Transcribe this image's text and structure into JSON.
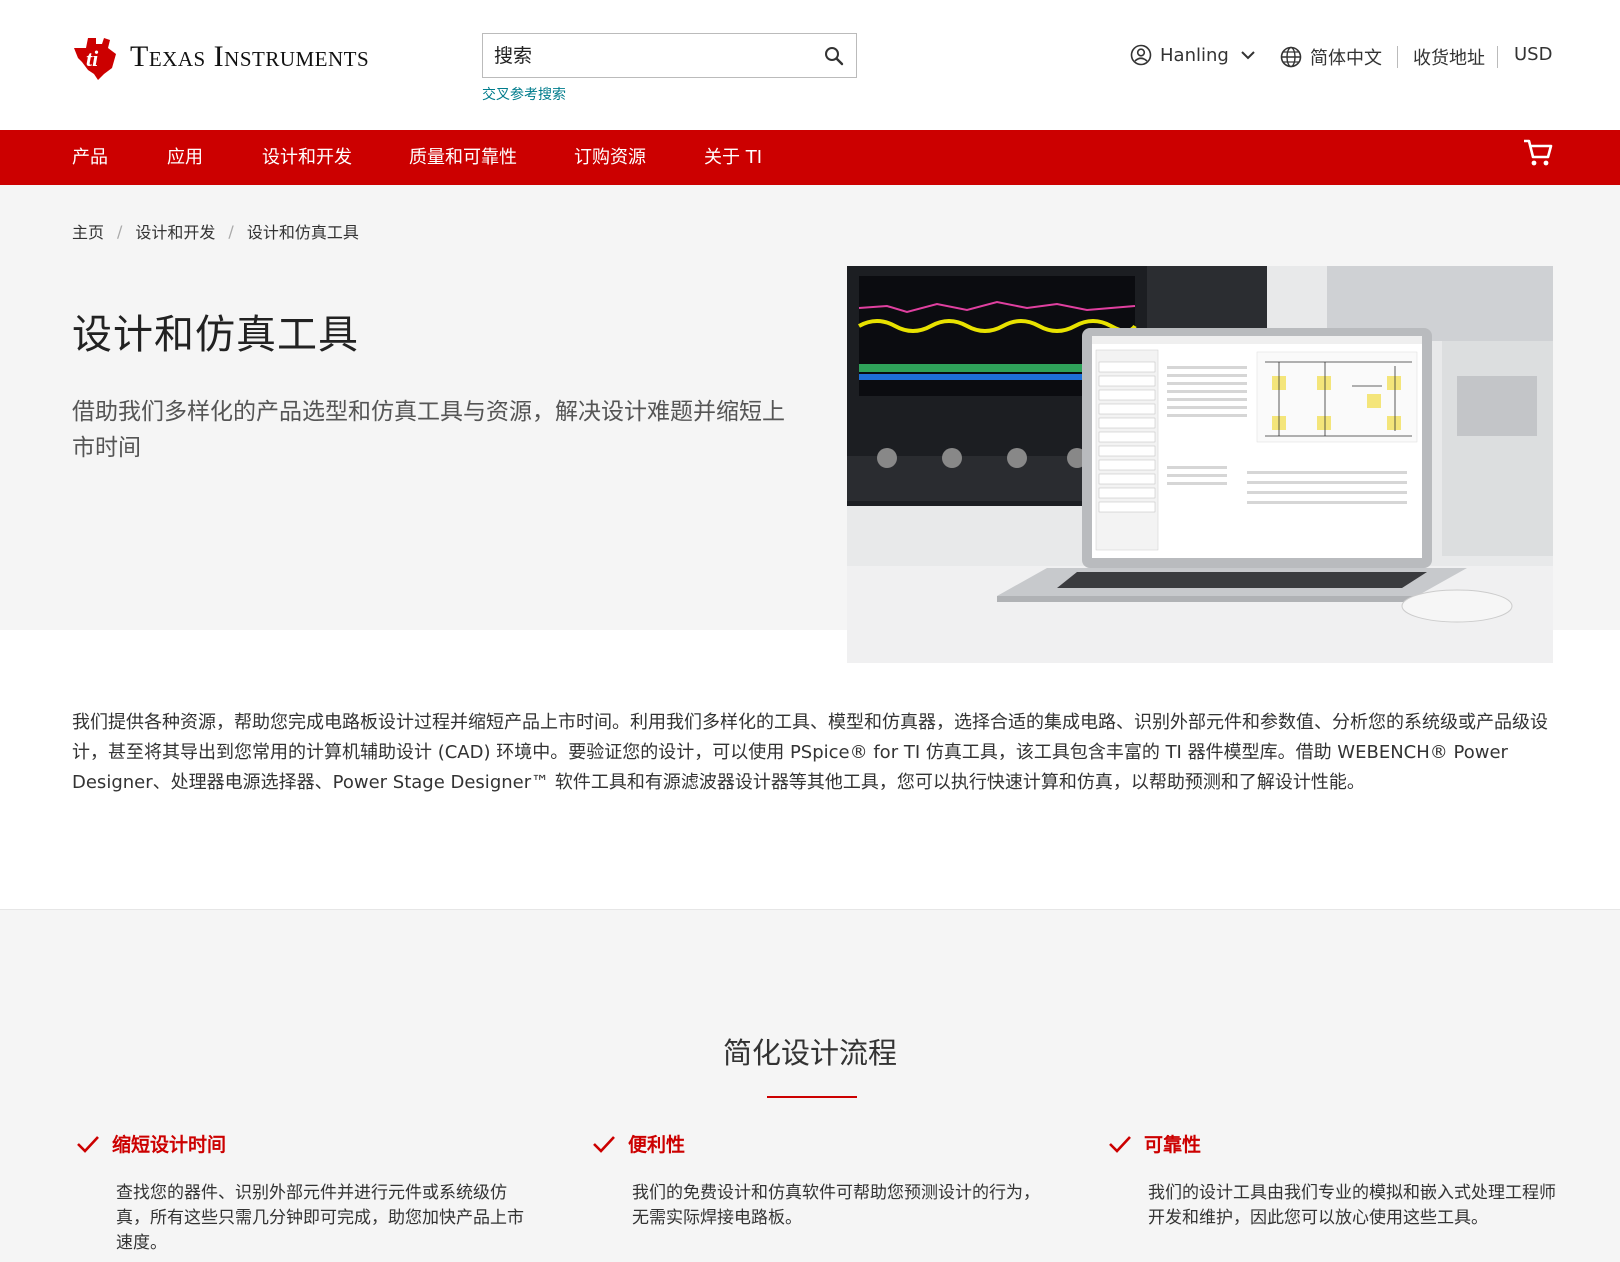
{
  "header": {
    "brand": "Texas Instruments",
    "search_placeholder": "搜索",
    "cross_ref_link": "交叉参考搜索",
    "user_name": "Hanling",
    "language": "简体中文",
    "shipping": "收货地址",
    "currency": "USD"
  },
  "nav": {
    "items": [
      {
        "label": "产品"
      },
      {
        "label": "应用"
      },
      {
        "label": "设计和开发"
      },
      {
        "label": "质量和可靠性"
      },
      {
        "label": "订购资源"
      },
      {
        "label": "关于 TI"
      }
    ]
  },
  "breadcrumb": [
    {
      "label": "主页"
    },
    {
      "label": "设计和开发"
    },
    {
      "label": "设计和仿真工具"
    }
  ],
  "hero": {
    "title": "设计和仿真工具",
    "subtitle": "借助我们多样化的产品选型和仿真工具与资源，解决设计难题并缩短上市时间"
  },
  "intro": "我们提供各种资源，帮助您完成电路板设计过程并缩短产品上市时间。利用我们多样化的工具、模型和仿真器，选择合适的集成电路、识别外部元件和参数值、分析您的系统级或产品级设计，甚至将其导出到您常用的计算机辅助设计 (CAD) 环境中。要验证您的设计，可以使用 PSpice® for TI 仿真工具，该工具包含丰富的 TI 器件模型库。借助 WEBENCH® Power Designer、处理器电源选择器、Power Stage Designer™ 软件工具和有源滤波器设计器等其他工具，您可以执行快速计算和仿真，以帮助预测和了解设计性能。",
  "section": {
    "title": "简化设计流程",
    "features": [
      {
        "title": "缩短设计时间",
        "desc": "查找您的器件、识别外部元件并进行元件或系统级仿真，所有这些只需几分钟即可完成，助您加快产品上市速度。"
      },
      {
        "title": "便利性",
        "desc": "我们的免费设计和仿真软件可帮助您预测设计的行为，无需实际焊接电路板。"
      },
      {
        "title": "可靠性",
        "desc": "我们的设计工具由我们专业的模拟和嵌入式处理工程师开发和维护，因此您可以放心使用这些工具。"
      }
    ]
  },
  "colors": {
    "accent": "#cc0000",
    "link": "#007c8c",
    "hero_bg": "#f5f5f5"
  },
  "icons": [
    "ti-logo-icon",
    "search-icon",
    "user-icon",
    "chevron-down-icon",
    "globe-icon",
    "cart-icon",
    "check-icon"
  ]
}
